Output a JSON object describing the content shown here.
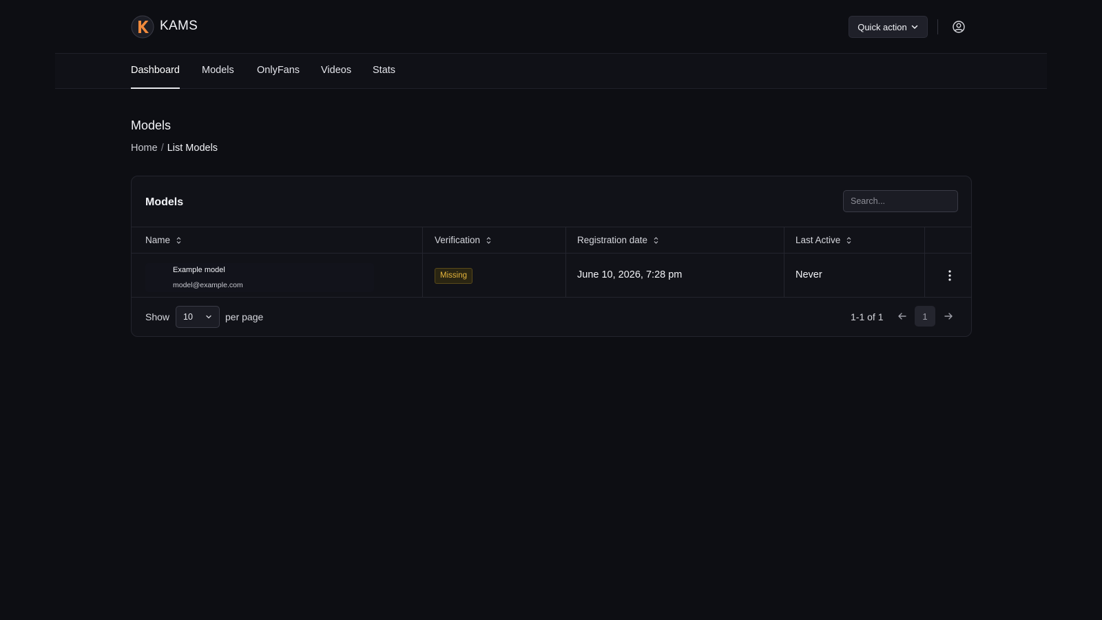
{
  "app": {
    "name": "KAMS",
    "logo_letter": "K"
  },
  "header": {
    "quick_action_label": "Quick action"
  },
  "nav": {
    "items": [
      {
        "label": "Dashboard",
        "active": true
      },
      {
        "label": "Models",
        "active": false
      },
      {
        "label": "OnlyFans",
        "active": false
      },
      {
        "label": "Videos",
        "active": false
      },
      {
        "label": "Stats",
        "active": false
      }
    ]
  },
  "page": {
    "title": "Models",
    "breadcrumb": {
      "home": "Home",
      "separator": "/",
      "current": "List Models"
    }
  },
  "card": {
    "title": "Models",
    "search_placeholder": "Search...",
    "columns": [
      "Name",
      "Verification",
      "Registration date",
      "Last Active"
    ],
    "rows": [
      {
        "name": "Example model",
        "email": "model@example.com",
        "verification": "Missing",
        "registration_date": "June 10, 2026, 7:28 pm",
        "last_active": "Never"
      }
    ],
    "footer": {
      "show_label": "Show",
      "per_page_value": "10",
      "per_page_label": "per page",
      "range": "1-1 of 1",
      "current_page": "1"
    }
  },
  "colors": {
    "background": "#0d0e13",
    "accent_orange": "#f08a3c",
    "badge_warning": "#e5b53c"
  }
}
